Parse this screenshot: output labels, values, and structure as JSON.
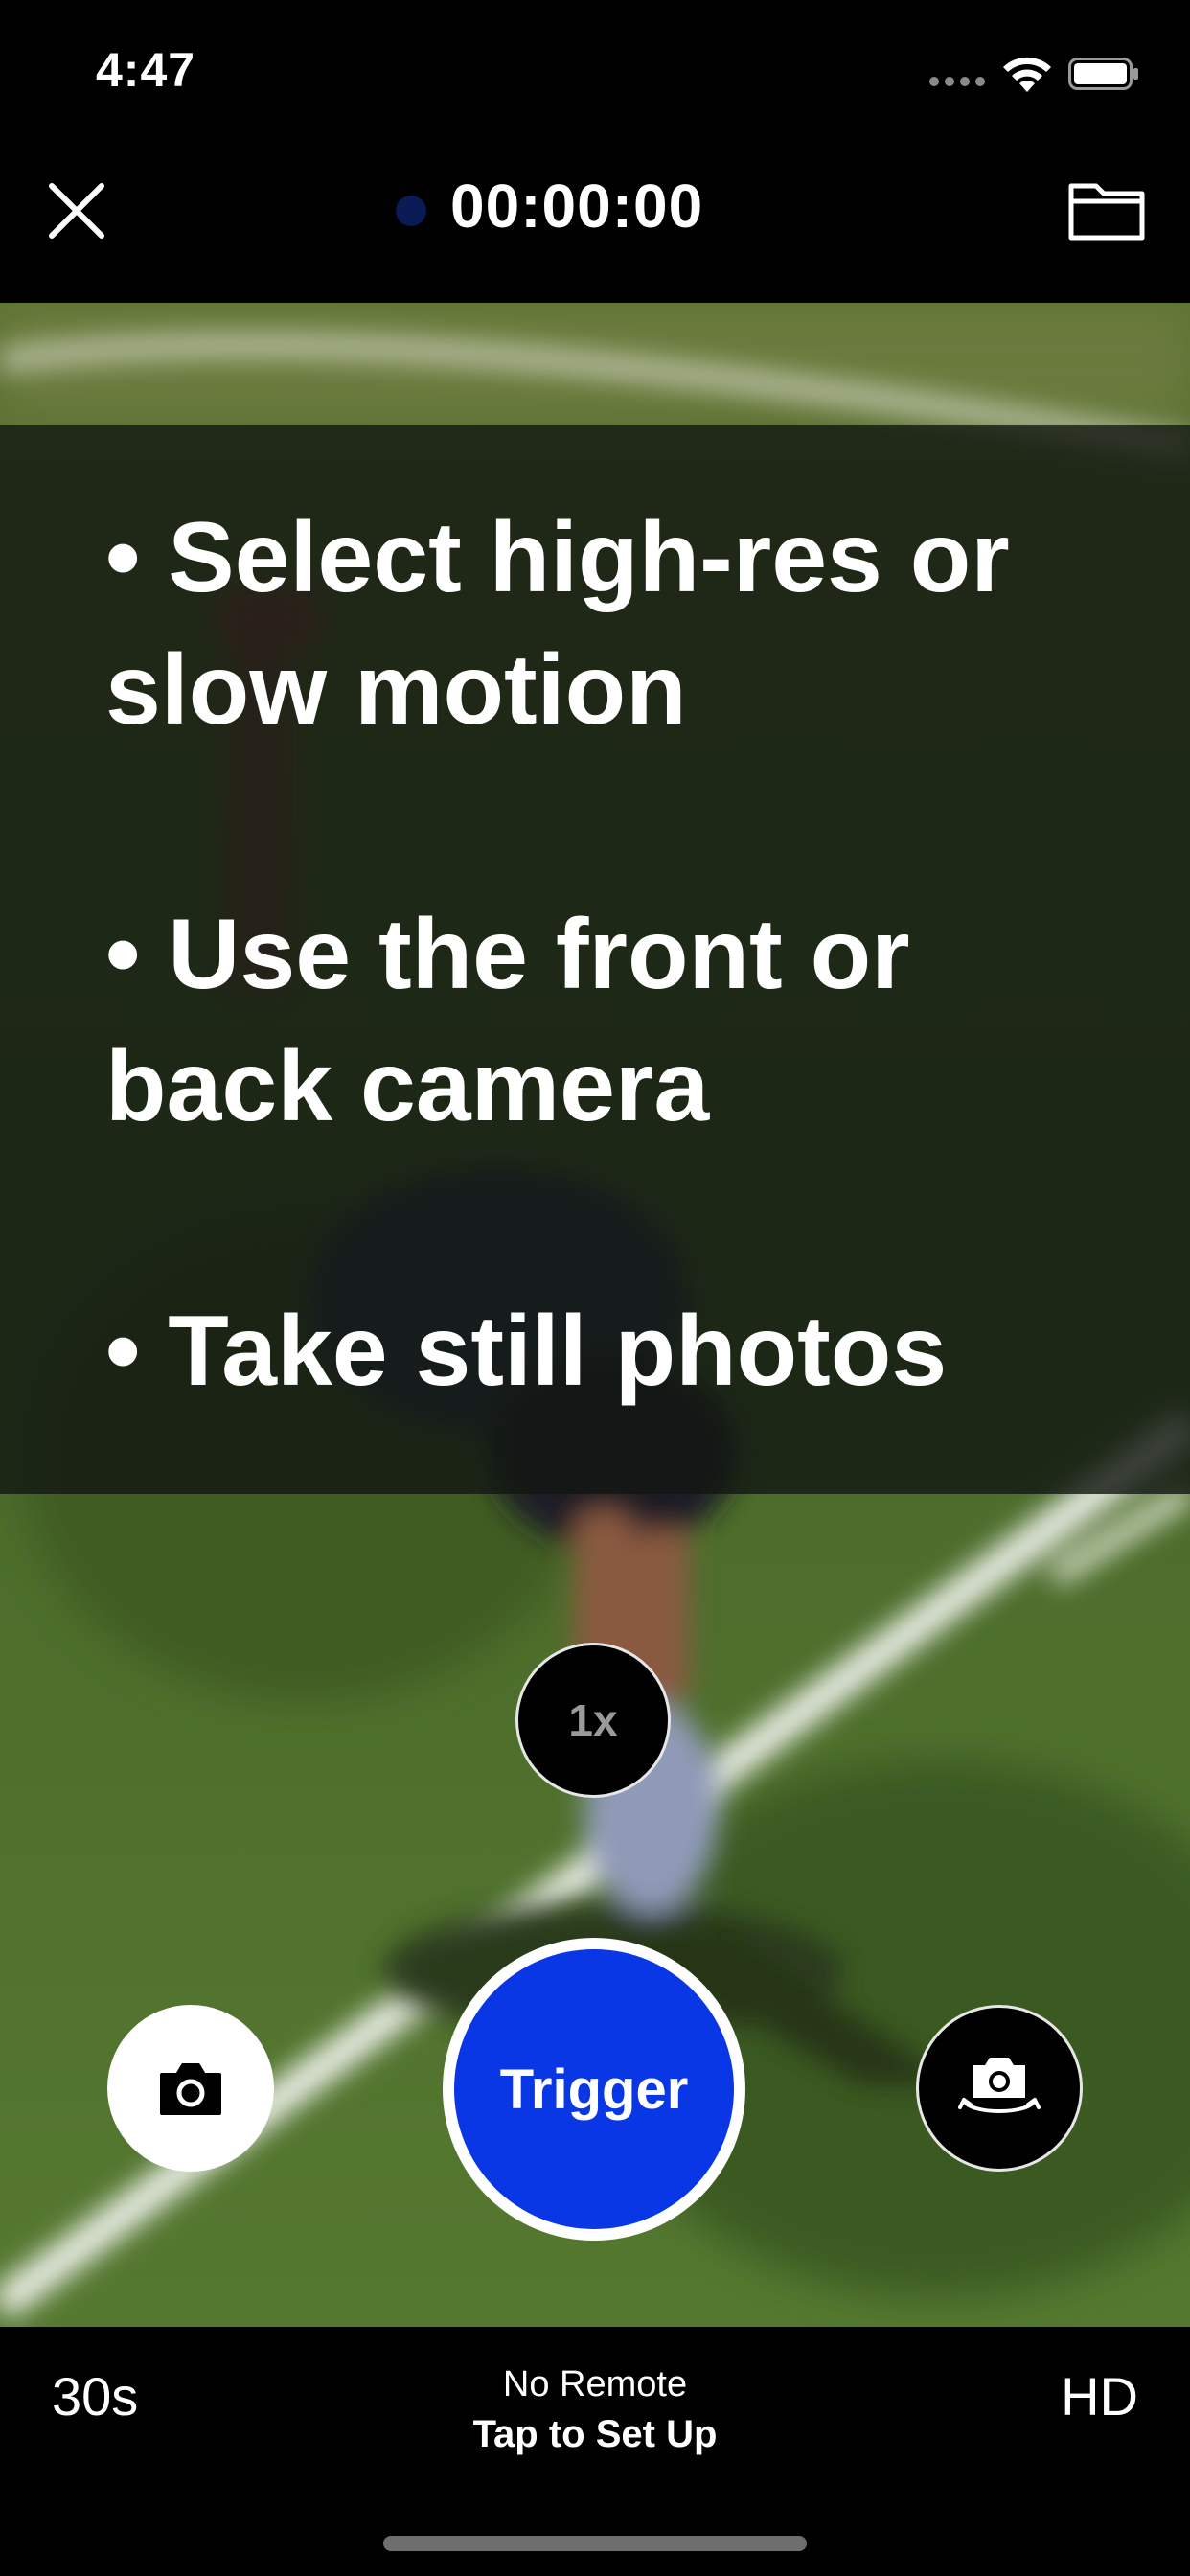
{
  "status_bar": {
    "time": "4:47"
  },
  "top_nav": {
    "timer": "00:00:00"
  },
  "tips": [
    "• Select high-res or slow motion",
    "• Use the front or back camera",
    "• Take still photos"
  ],
  "controls": {
    "zoom_label": "1x",
    "trigger_label": "Trigger"
  },
  "bottom_bar": {
    "duration": "30s",
    "remote_status": "No Remote",
    "remote_action": "Tap to Set Up",
    "quality": "HD"
  },
  "colors": {
    "trigger": "#0a37e6",
    "turf": "#4c6a2c",
    "background": "#000000"
  },
  "icons": [
    "close-icon",
    "folder-icon",
    "camera-icon",
    "flip-camera-icon",
    "wifi-icon",
    "battery-icon",
    "signal-icon"
  ]
}
